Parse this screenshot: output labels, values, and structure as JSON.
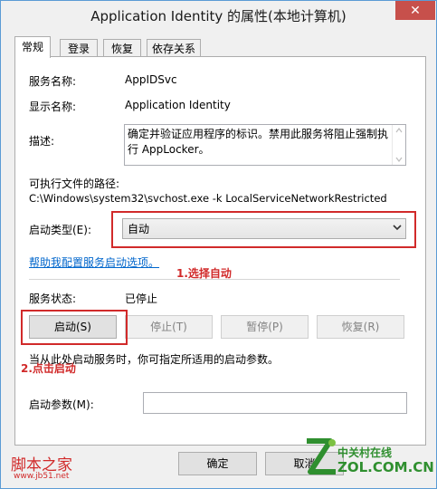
{
  "window": {
    "title": "Application Identity 的属性(本地计算机)",
    "close_glyph": "✕"
  },
  "tabs": [
    {
      "label": "常规"
    },
    {
      "label": "登录"
    },
    {
      "label": "恢复"
    },
    {
      "label": "依存关系"
    }
  ],
  "general": {
    "service_name_label": "服务名称:",
    "service_name_value": "AppIDSvc",
    "display_name_label": "显示名称:",
    "display_name_value": "Application Identity",
    "description_label": "描述:",
    "description_value": "确定并验证应用程序的标识。禁用此服务将阻止强制执行 AppLocker。",
    "exec_path_label": "可执行文件的路径:",
    "exec_path_value": "C:\\Windows\\system32\\svchost.exe -k LocalServiceNetworkRestricted",
    "startup_type_label": "启动类型(E):",
    "startup_type_value": "自动",
    "help_link": "帮助我配置服务启动选项。",
    "service_status_label": "服务状态:",
    "service_status_value": "已停止",
    "start_button": "启动(S)",
    "stop_button": "停止(T)",
    "pause_button": "暂停(P)",
    "resume_button": "恢复(R)",
    "hint_text": "当从此处启动服务时，你可指定所适用的启动参数。",
    "start_params_label": "启动参数(M):",
    "start_params_value": ""
  },
  "footer": {
    "ok_button": "确定",
    "cancel_button": "取消"
  },
  "annotations": {
    "step1": "1.选择自动",
    "step2": "2.点击启动",
    "annotation_color": "#d12a2a"
  },
  "watermarks": {
    "left_brand": "脚本之家",
    "left_url": "www.jb51.net",
    "right_brand": "中关村在线",
    "right_url": "ZOL.COM.CN"
  }
}
